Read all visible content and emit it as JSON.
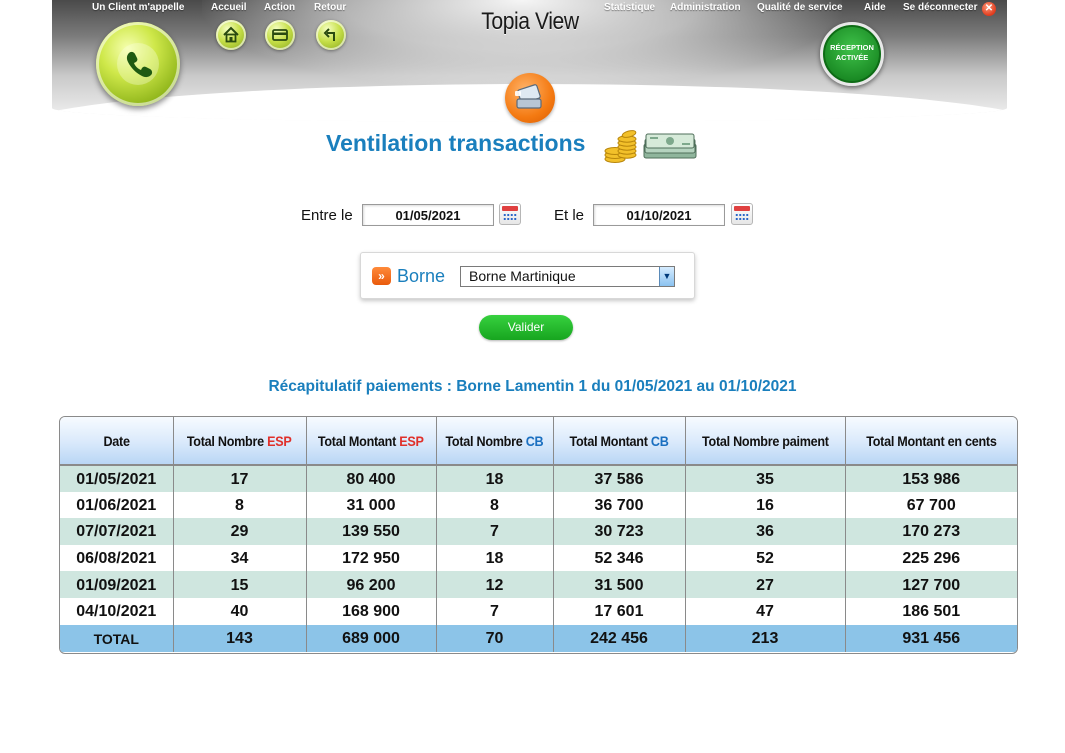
{
  "header": {
    "client_link": "Un Client m'appelle",
    "nav": {
      "accueil": "Accueil",
      "action": "Action",
      "retour": "Retour"
    },
    "app_title": "Topia View",
    "menu": {
      "statistique": "Statistique",
      "administration": "Administration",
      "qualite": "Qualité de service",
      "aide": "Aide",
      "deconnecter": "Se déconnecter"
    },
    "reception_badge": {
      "line1": "RÉCEPTION",
      "line2": "ACTIVÉE"
    }
  },
  "page": {
    "title": "Ventilation transactions"
  },
  "filter": {
    "from_label": "Entre le",
    "from_date": "01/05/2021",
    "to_label": "Et le",
    "to_date": "01/10/2021",
    "borne_label": "Borne",
    "borne_selected": "Borne Martinique",
    "validate_label": "Valider"
  },
  "recap_title": "Récapitulatif paiements : Borne Lamentin 1 du 01/05/2021 au 01/10/2021",
  "table": {
    "headers": {
      "date": "Date",
      "nb_esp_prefix": "Total Nombre ",
      "nb_esp_suffix": "ESP",
      "mt_esp_prefix": "Total Montant ",
      "mt_esp_suffix": "ESP",
      "nb_cb_prefix": "Total Nombre ",
      "nb_cb_suffix": "CB",
      "mt_cb_prefix": "Total Montant ",
      "mt_cb_suffix": "CB",
      "nb_paiement": "Total Nombre paiment",
      "mt_cents": "Total Montant en cents"
    },
    "rows": [
      {
        "date": "01/05/2021",
        "nb_esp": "17",
        "mt_esp": "80 400",
        "nb_cb": "18",
        "mt_cb": "37 586",
        "nb_paiement": "35",
        "mt_cents": "153 986"
      },
      {
        "date": "01/06/2021",
        "nb_esp": "8",
        "mt_esp": "31 000",
        "nb_cb": "8",
        "mt_cb": "36 700",
        "nb_paiement": "16",
        "mt_cents": "67 700"
      },
      {
        "date": "07/07/2021",
        "nb_esp": "29",
        "mt_esp": "139 550",
        "nb_cb": "7",
        "mt_cb": "30 723",
        "nb_paiement": "36",
        "mt_cents": "170 273"
      },
      {
        "date": "06/08/2021",
        "nb_esp": "34",
        "mt_esp": "172 950",
        "nb_cb": "18",
        "mt_cb": "52 346",
        "nb_paiement": "52",
        "mt_cents": "225 296"
      },
      {
        "date": "01/09/2021",
        "nb_esp": "15",
        "mt_esp": "96 200",
        "nb_cb": "12",
        "mt_cb": "31 500",
        "nb_paiement": "27",
        "mt_cents": "127 700"
      },
      {
        "date": "04/10/2021",
        "nb_esp": "40",
        "mt_esp": "168 900",
        "nb_cb": "7",
        "mt_cb": "17 601",
        "nb_paiement": "47",
        "mt_cents": "186 501"
      }
    ],
    "total": {
      "label": "TOTAL",
      "nb_esp": "143",
      "mt_esp": "689 000",
      "nb_cb": "70",
      "mt_cb": "242 456",
      "nb_paiement": "213",
      "mt_cents": "931 456"
    }
  },
  "colors": {
    "accent_blue": "#1a7fbd",
    "esp_red": "#e0302a",
    "cb_blue": "#1a6fc0",
    "row_tint": "#cfe6df",
    "total_row": "#8cc4e8",
    "validate_green": "#17a51f"
  },
  "icons": {
    "phone": "phone-icon",
    "home": "home-icon",
    "action": "action-icon",
    "back": "back-icon",
    "close": "close-icon",
    "page": "transactions-icon",
    "coins": "coins-icon",
    "bills": "bills-icon",
    "calendar": "calendar-icon",
    "borne_arrow": "double-chevron-icon"
  }
}
